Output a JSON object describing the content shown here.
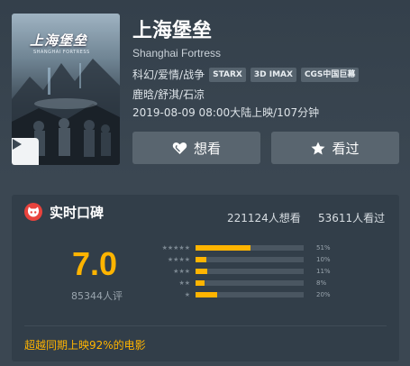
{
  "movie": {
    "poster_title": "上海堡垒",
    "poster_subtitle": "SHANGHAI FORTRESS",
    "title": "上海堡垒",
    "english_title": "Shanghai Fortress",
    "genres": "科幻/爱情/战争",
    "tags": [
      "STARX",
      "3D IMAX",
      "CGS中国巨幕"
    ],
    "cast": "鹿晗/舒淇/石凉",
    "release": "2019-08-09 08:00大陆上映/107分钟"
  },
  "actions": {
    "want_label": "想看",
    "seen_label": "看过"
  },
  "rating_panel": {
    "title": "实时口碑",
    "want_count": "221124人想看",
    "seen_count": "53611人看过",
    "score": "7.0",
    "rating_count": "85344人评",
    "distribution": [
      {
        "stars": "★★★★★",
        "percent_label": "51%",
        "fraction": 0.51
      },
      {
        "stars": "★★★★",
        "percent_label": "10%",
        "fraction": 0.1
      },
      {
        "stars": "★★★",
        "percent_label": "11%",
        "fraction": 0.11
      },
      {
        "stars": "★★",
        "percent_label": "8%",
        "fraction": 0.08
      },
      {
        "stars": "★",
        "percent_label": "20%",
        "fraction": 0.2
      }
    ],
    "beat_text": "超越同期上映92%的电影"
  },
  "colors": {
    "accent": "#ffb400",
    "logo": "#e8433d",
    "background": "#3b4752"
  },
  "icons": [
    "play-icon",
    "heart-icon",
    "star-icon",
    "cat-logo-icon"
  ]
}
